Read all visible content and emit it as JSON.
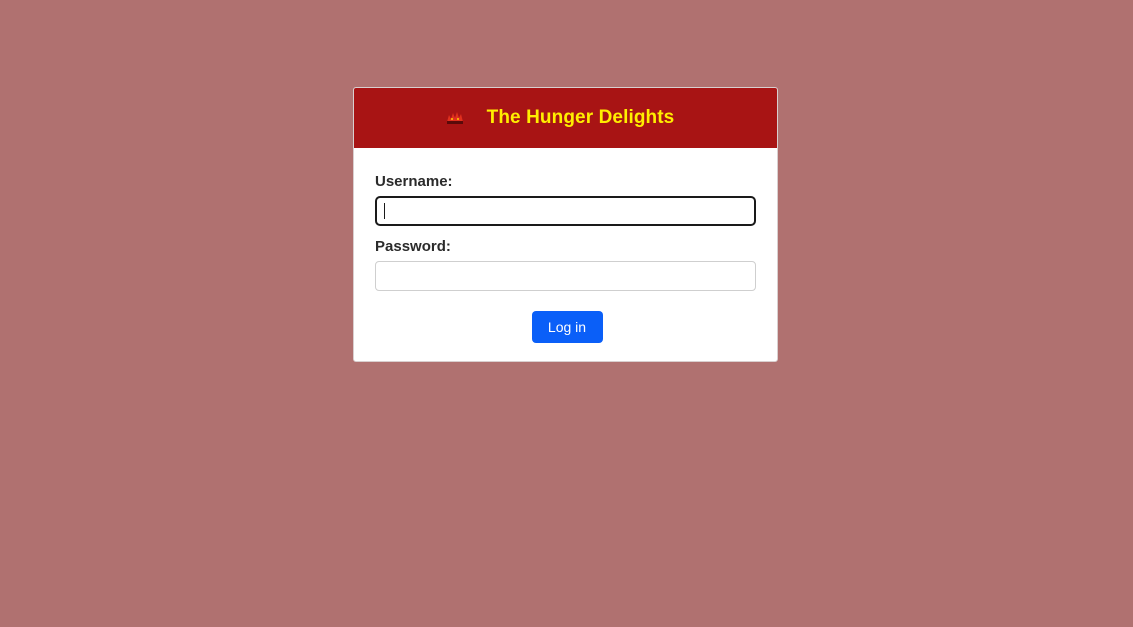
{
  "header": {
    "title": "The Hunger Delights",
    "logo_icon": "restaurant-logo-icon",
    "background_color": "#a81414",
    "title_color": "#ffee00"
  },
  "form": {
    "username_label": "Username:",
    "username_value": "",
    "password_label": "Password:",
    "password_value": "",
    "login_label": "Log in"
  },
  "colors": {
    "page_background": "#b07170",
    "button_color": "#0a5ff8"
  }
}
